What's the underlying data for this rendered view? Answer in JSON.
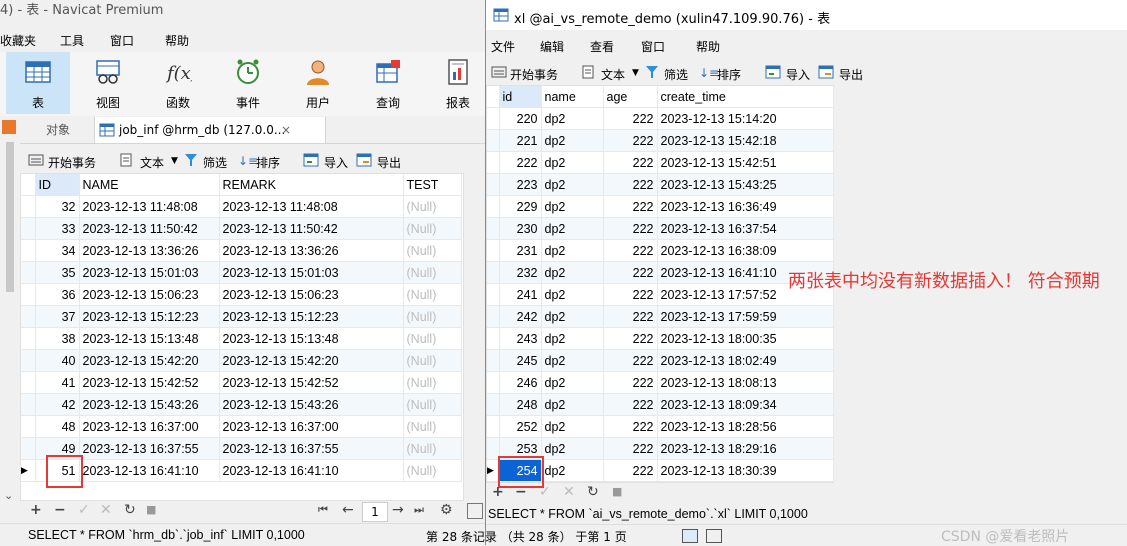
{
  "left": {
    "title": "4) - 表 - Navicat Premium",
    "menu": [
      "收藏夹",
      "工具",
      "窗口",
      "帮助"
    ],
    "ribbon": [
      {
        "label": "表",
        "icon": "table-icon",
        "active": true
      },
      {
        "label": "视图",
        "icon": "view-icon"
      },
      {
        "label": "函数",
        "icon": "function-icon"
      },
      {
        "label": "事件",
        "icon": "event-clock-icon"
      },
      {
        "label": "用户",
        "icon": "user-icon"
      },
      {
        "label": "查询",
        "icon": "query-icon"
      },
      {
        "label": "报表",
        "icon": "report-icon"
      }
    ],
    "tabs": {
      "objects": "对象",
      "active": "job_inf @hrm_db (127.0.0...",
      "close": "×"
    },
    "toolbar": {
      "begin_txn": "开始事务",
      "text": "文本",
      "filter": "筛选",
      "sort": "排序",
      "import": "导入",
      "export": "导出"
    },
    "columns": [
      "ID",
      "NAME",
      "REMARK",
      "TEST"
    ],
    "rows": [
      [
        "32",
        "2023-12-13 11:48:08",
        "2023-12-13 11:48:08",
        "(Null)"
      ],
      [
        "33",
        "2023-12-13 11:50:42",
        "2023-12-13 11:50:42",
        "(Null)"
      ],
      [
        "34",
        "2023-12-13 13:36:26",
        "2023-12-13 13:36:26",
        "(Null)"
      ],
      [
        "35",
        "2023-12-13 15:01:03",
        "2023-12-13 15:01:03",
        "(Null)"
      ],
      [
        "36",
        "2023-12-13 15:06:23",
        "2023-12-13 15:06:23",
        "(Null)"
      ],
      [
        "37",
        "2023-12-13 15:12:23",
        "2023-12-13 15:12:23",
        "(Null)"
      ],
      [
        "38",
        "2023-12-13 15:13:48",
        "2023-12-13 15:13:48",
        "(Null)"
      ],
      [
        "40",
        "2023-12-13 15:42:20",
        "2023-12-13 15:42:20",
        "(Null)"
      ],
      [
        "41",
        "2023-12-13 15:42:52",
        "2023-12-13 15:42:52",
        "(Null)"
      ],
      [
        "42",
        "2023-12-13 15:43:26",
        "2023-12-13 15:43:26",
        "(Null)"
      ],
      [
        "48",
        "2023-12-13 16:37:00",
        "2023-12-13 16:37:00",
        "(Null)"
      ],
      [
        "49",
        "2023-12-13 16:37:55",
        "2023-12-13 16:37:55",
        "(Null)"
      ],
      [
        "51",
        "2023-12-13 16:41:10",
        "2023-12-13 16:41:10",
        "(Null)"
      ]
    ],
    "page_number": "1",
    "sql": "SELECT * FROM `hrm_db`.`job_inf` LIMIT 0,1000",
    "record_status": "第 28 条记录 （共 28 条） 于第 1 页"
  },
  "right": {
    "title": "xl @ai_vs_remote_demo (xulin47.109.90.76) - 表",
    "menu": [
      "文件",
      "编辑",
      "查看",
      "窗口",
      "帮助"
    ],
    "toolbar": {
      "begin_txn": "开始事务",
      "text": "文本",
      "filter": "筛选",
      "sort": "排序",
      "import": "导入",
      "export": "导出"
    },
    "columns": [
      "id",
      "name",
      "age",
      "create_time"
    ],
    "rows": [
      [
        "220",
        "dp2",
        "222",
        "2023-12-13 15:14:20"
      ],
      [
        "221",
        "dp2",
        "222",
        "2023-12-13 15:42:18"
      ],
      [
        "222",
        "dp2",
        "222",
        "2023-12-13 15:42:51"
      ],
      [
        "223",
        "dp2",
        "222",
        "2023-12-13 15:43:25"
      ],
      [
        "229",
        "dp2",
        "222",
        "2023-12-13 16:36:49"
      ],
      [
        "230",
        "dp2",
        "222",
        "2023-12-13 16:37:54"
      ],
      [
        "231",
        "dp2",
        "222",
        "2023-12-13 16:38:09"
      ],
      [
        "232",
        "dp2",
        "222",
        "2023-12-13 16:41:10"
      ],
      [
        "241",
        "dp2",
        "222",
        "2023-12-13 17:57:52"
      ],
      [
        "242",
        "dp2",
        "222",
        "2023-12-13 17:59:59"
      ],
      [
        "243",
        "dp2",
        "222",
        "2023-12-13 18:00:35"
      ],
      [
        "245",
        "dp2",
        "222",
        "2023-12-13 18:02:49"
      ],
      [
        "246",
        "dp2",
        "222",
        "2023-12-13 18:08:13"
      ],
      [
        "248",
        "dp2",
        "222",
        "2023-12-13 18:09:34"
      ],
      [
        "252",
        "dp2",
        "222",
        "2023-12-13 18:28:56"
      ],
      [
        "253",
        "dp2",
        "222",
        "2023-12-13 18:29:16"
      ],
      [
        "254",
        "dp2",
        "222",
        "2023-12-13 18:30:39"
      ]
    ],
    "sql": "SELECT * FROM `ai_vs_remote_demo`.`xl` LIMIT 0,1000"
  },
  "annotation": "两张表中均没有新数据插入！ 符合预期",
  "watermark": "CSDN @爱看老照片",
  "colors": {
    "highlight_red": "#e53935",
    "selected_blue": "#0a64d6",
    "ribbon_active": "#cce4f7"
  }
}
